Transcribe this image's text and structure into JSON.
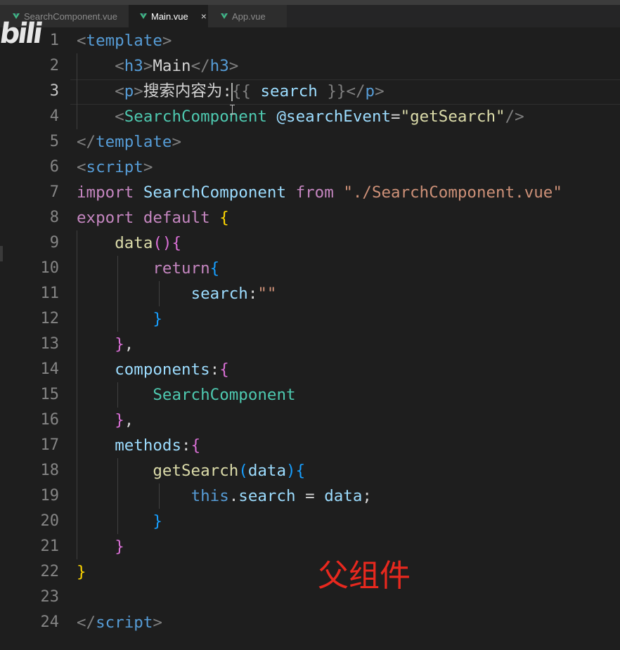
{
  "tabs": [
    {
      "label": "SearchComponent.vue",
      "active": false,
      "icon": "vue-icon"
    },
    {
      "label": "Main.vue",
      "active": true,
      "icon": "vue-icon",
      "close": "×"
    },
    {
      "label": "App.vue",
      "active": false,
      "icon": "vue-icon"
    }
  ],
  "watermark": "bili",
  "annotation": "父组件",
  "lines": [
    {
      "num": "1",
      "tokens": [
        [
          "<",
          "t-punc"
        ],
        [
          "template",
          "t-tag"
        ],
        [
          ">",
          "t-punc"
        ]
      ]
    },
    {
      "num": "2",
      "tokens": [
        [
          "    ",
          ""
        ],
        [
          "<",
          "t-punc"
        ],
        [
          "h3",
          "t-tag"
        ],
        [
          ">",
          "t-punc"
        ],
        [
          "Main",
          "t-text"
        ],
        [
          "</",
          "t-punc"
        ],
        [
          "h3",
          "t-tag"
        ],
        [
          ">",
          "t-punc"
        ]
      ]
    },
    {
      "num": "3",
      "tokens": [
        [
          "    ",
          ""
        ],
        [
          "<",
          "t-punc"
        ],
        [
          "p",
          "t-tag"
        ],
        [
          ">",
          "t-punc"
        ],
        [
          "搜索内容为:",
          "t-text"
        ],
        [
          "|caret",
          ""
        ],
        [
          "{{ ",
          "t-punc"
        ],
        [
          "search",
          "t-var"
        ],
        [
          " }}",
          "t-punc"
        ],
        [
          "</",
          "t-punc"
        ],
        [
          "p",
          "t-tag"
        ],
        [
          ">",
          "t-punc"
        ]
      ]
    },
    {
      "num": "4",
      "tokens": [
        [
          "    ",
          ""
        ],
        [
          "<",
          "t-punc"
        ],
        [
          "SearchComponent",
          "t-comp"
        ],
        [
          " ",
          ""
        ],
        [
          "@searchEvent",
          "t-attr"
        ],
        [
          "=",
          "t-text"
        ],
        [
          "\"getSearch\"",
          "t-str2"
        ],
        [
          "/>",
          "t-punc"
        ]
      ]
    },
    {
      "num": "5",
      "tokens": [
        [
          "</",
          "t-punc"
        ],
        [
          "template",
          "t-tag"
        ],
        [
          ">",
          "t-punc"
        ]
      ]
    },
    {
      "num": "6",
      "tokens": [
        [
          "<",
          "t-punc"
        ],
        [
          "script",
          "t-tag"
        ],
        [
          ">",
          "t-punc"
        ]
      ]
    },
    {
      "num": "7",
      "tokens": [
        [
          "import",
          "t-kw"
        ],
        [
          " ",
          ""
        ],
        [
          "SearchComponent",
          "t-var"
        ],
        [
          " ",
          ""
        ],
        [
          "from",
          "t-kw"
        ],
        [
          " ",
          ""
        ],
        [
          "\"./SearchComponent.vue\"",
          "t-str"
        ]
      ]
    },
    {
      "num": "8",
      "tokens": [
        [
          "export",
          "t-kw"
        ],
        [
          " ",
          ""
        ],
        [
          "default",
          "t-kw"
        ],
        [
          " ",
          ""
        ],
        [
          "{",
          "t-b1"
        ]
      ]
    },
    {
      "num": "9",
      "tokens": [
        [
          "    ",
          ""
        ],
        [
          "data",
          "t-fn"
        ],
        [
          "(){",
          "t-b2"
        ]
      ]
    },
    {
      "num": "10",
      "tokens": [
        [
          "        ",
          ""
        ],
        [
          "return",
          "t-kw"
        ],
        [
          "{",
          "t-b3"
        ]
      ]
    },
    {
      "num": "11",
      "tokens": [
        [
          "            ",
          ""
        ],
        [
          "search",
          "t-var"
        ],
        [
          ":",
          "t-text"
        ],
        [
          "\"\"",
          "t-str"
        ]
      ]
    },
    {
      "num": "12",
      "tokens": [
        [
          "        ",
          ""
        ],
        [
          "}",
          "t-b3"
        ]
      ]
    },
    {
      "num": "13",
      "tokens": [
        [
          "    ",
          ""
        ],
        [
          "}",
          "t-b2"
        ],
        [
          ",",
          "t-text"
        ]
      ]
    },
    {
      "num": "14",
      "tokens": [
        [
          "    ",
          ""
        ],
        [
          "components",
          "t-var"
        ],
        [
          ":",
          "t-text"
        ],
        [
          "{",
          "t-b2"
        ]
      ]
    },
    {
      "num": "15",
      "tokens": [
        [
          "        ",
          ""
        ],
        [
          "SearchComponent",
          "t-comp"
        ]
      ]
    },
    {
      "num": "16",
      "tokens": [
        [
          "    ",
          ""
        ],
        [
          "}",
          "t-b2"
        ],
        [
          ",",
          "t-text"
        ]
      ]
    },
    {
      "num": "17",
      "tokens": [
        [
          "    ",
          ""
        ],
        [
          "methods",
          "t-var"
        ],
        [
          ":",
          "t-text"
        ],
        [
          "{",
          "t-b2"
        ]
      ]
    },
    {
      "num": "18",
      "tokens": [
        [
          "        ",
          ""
        ],
        [
          "getSearch",
          "t-fn"
        ],
        [
          "(",
          "t-b3"
        ],
        [
          "data",
          "t-var"
        ],
        [
          ")",
          "t-b3"
        ],
        [
          "{",
          "t-b3"
        ]
      ]
    },
    {
      "num": "19",
      "tokens": [
        [
          "            ",
          ""
        ],
        [
          "this",
          "t-this"
        ],
        [
          ".",
          "t-text"
        ],
        [
          "search",
          "t-var"
        ],
        [
          " = ",
          "t-text"
        ],
        [
          "data",
          "t-var"
        ],
        [
          ";",
          "t-text"
        ]
      ]
    },
    {
      "num": "20",
      "tokens": [
        [
          "        ",
          ""
        ],
        [
          "}",
          "t-b3"
        ]
      ]
    },
    {
      "num": "21",
      "tokens": [
        [
          "    ",
          ""
        ],
        [
          "}",
          "t-b2"
        ]
      ]
    },
    {
      "num": "22",
      "tokens": [
        [
          "}",
          "t-b1"
        ]
      ]
    },
    {
      "num": "23",
      "tokens": []
    },
    {
      "num": "24",
      "tokens": [
        [
          "</",
          "t-punc"
        ],
        [
          "script",
          "t-tag"
        ],
        [
          ">",
          "t-punc"
        ]
      ]
    }
  ],
  "active_line": "3"
}
